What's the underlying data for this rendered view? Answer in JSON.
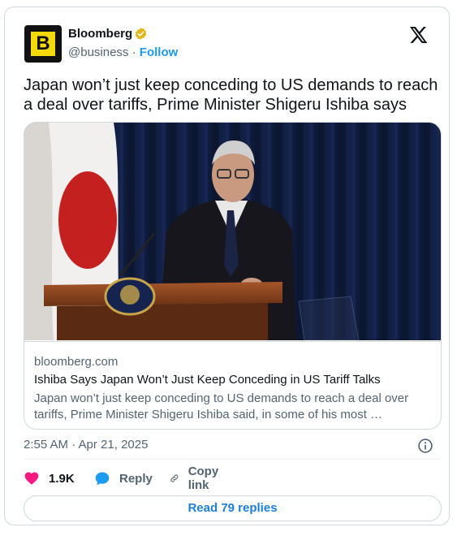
{
  "author": {
    "name": "Bloomberg",
    "handle": "@business",
    "separator": "·",
    "follow_label": "Follow",
    "avatar_letter": "B",
    "verified_color": "#e2b719"
  },
  "tweet": {
    "text": "Japan won’t just keep conceding to US demands to reach a deal over tariffs, Prime Minister Shigeru Ishiba says",
    "timestamp": "2:55 AM · Apr 21, 2025"
  },
  "link_card": {
    "domain": "bloomberg.com",
    "title": "Ishiba Says Japan Won’t Just Keep Conceding in US Tariff Talks",
    "description": "Japan won’t just keep conceding to US demands to reach a deal over tariffs, Prime Minister Shigeru Ishiba said, in some of his most …"
  },
  "actions": {
    "like_count": "1.9K",
    "reply_label": "Reply",
    "copy_label": "Copy link",
    "read_replies_label": "Read 79 replies"
  },
  "icons": {
    "brand": "x-logo-icon",
    "like": "heart-icon",
    "reply": "speech-bubble-icon",
    "copy": "link-icon",
    "info": "info-icon",
    "verified": "verified-badge-icon"
  },
  "colors": {
    "like": "#f91880",
    "reply": "#1d9bf0",
    "follow": "#1d9bf0",
    "muted": "#536471",
    "border": "#cfd9de"
  }
}
